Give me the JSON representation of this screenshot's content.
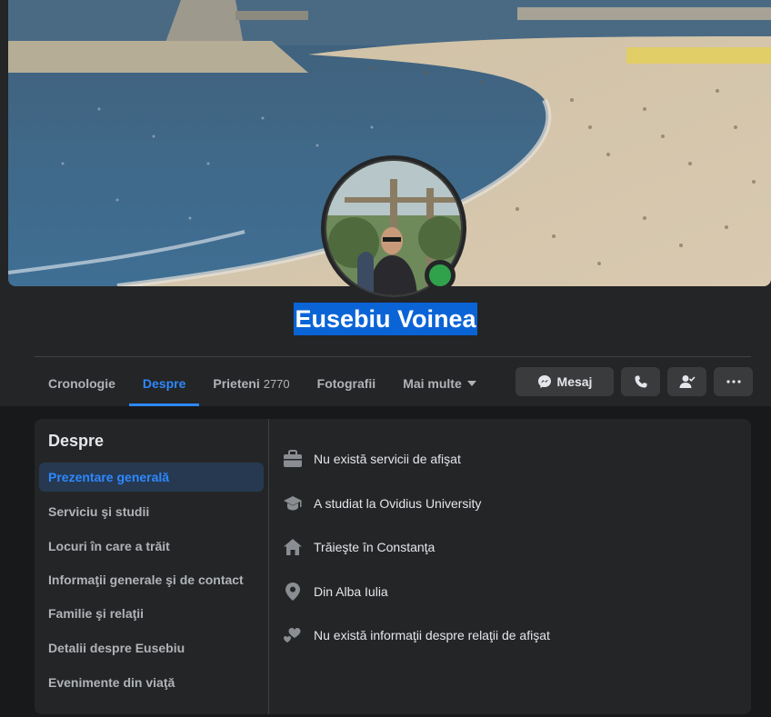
{
  "profile": {
    "name": "Eusebiu Voinea",
    "online": true
  },
  "tabs": [
    {
      "label": "Cronologie",
      "active": false
    },
    {
      "label": "Despre",
      "active": true
    },
    {
      "label": "Prieteni",
      "count": "2770",
      "active": false
    },
    {
      "label": "Fotografii",
      "active": false
    },
    {
      "label": "Mai multe",
      "active": false
    }
  ],
  "actions": {
    "message_label": "Mesaj",
    "call_icon": "phone-icon",
    "friend_icon": "friend-check-icon",
    "more_icon": "ellipsis-icon"
  },
  "about": {
    "title": "Despre",
    "nav": [
      {
        "label": "Prezentare generală",
        "active": true
      },
      {
        "label": "Serviciu şi studii"
      },
      {
        "label": "Locuri în care a trăit"
      },
      {
        "label": "Informaţii generale şi de contact"
      },
      {
        "label": "Familie şi relaţii"
      },
      {
        "label": "Detalii despre Eusebiu"
      },
      {
        "label": "Evenimente din viaţă"
      }
    ],
    "items": [
      {
        "icon": "briefcase-icon",
        "text": "Nu există servicii de afişat"
      },
      {
        "icon": "graduation-cap-icon",
        "text": "A studiat la Ovidius University"
      },
      {
        "icon": "home-icon",
        "text": "Trăieşte în Constanţa"
      },
      {
        "icon": "location-pin-icon",
        "text": "Din Alba Iulia"
      },
      {
        "icon": "hearts-icon",
        "text": "Nu există informaţii despre relaţii de afişat"
      }
    ]
  },
  "colors": {
    "accent": "#2d88ff",
    "online": "#31a24c",
    "name_highlight": "#0a64d6",
    "surface": "#242526",
    "background": "#18191a"
  }
}
